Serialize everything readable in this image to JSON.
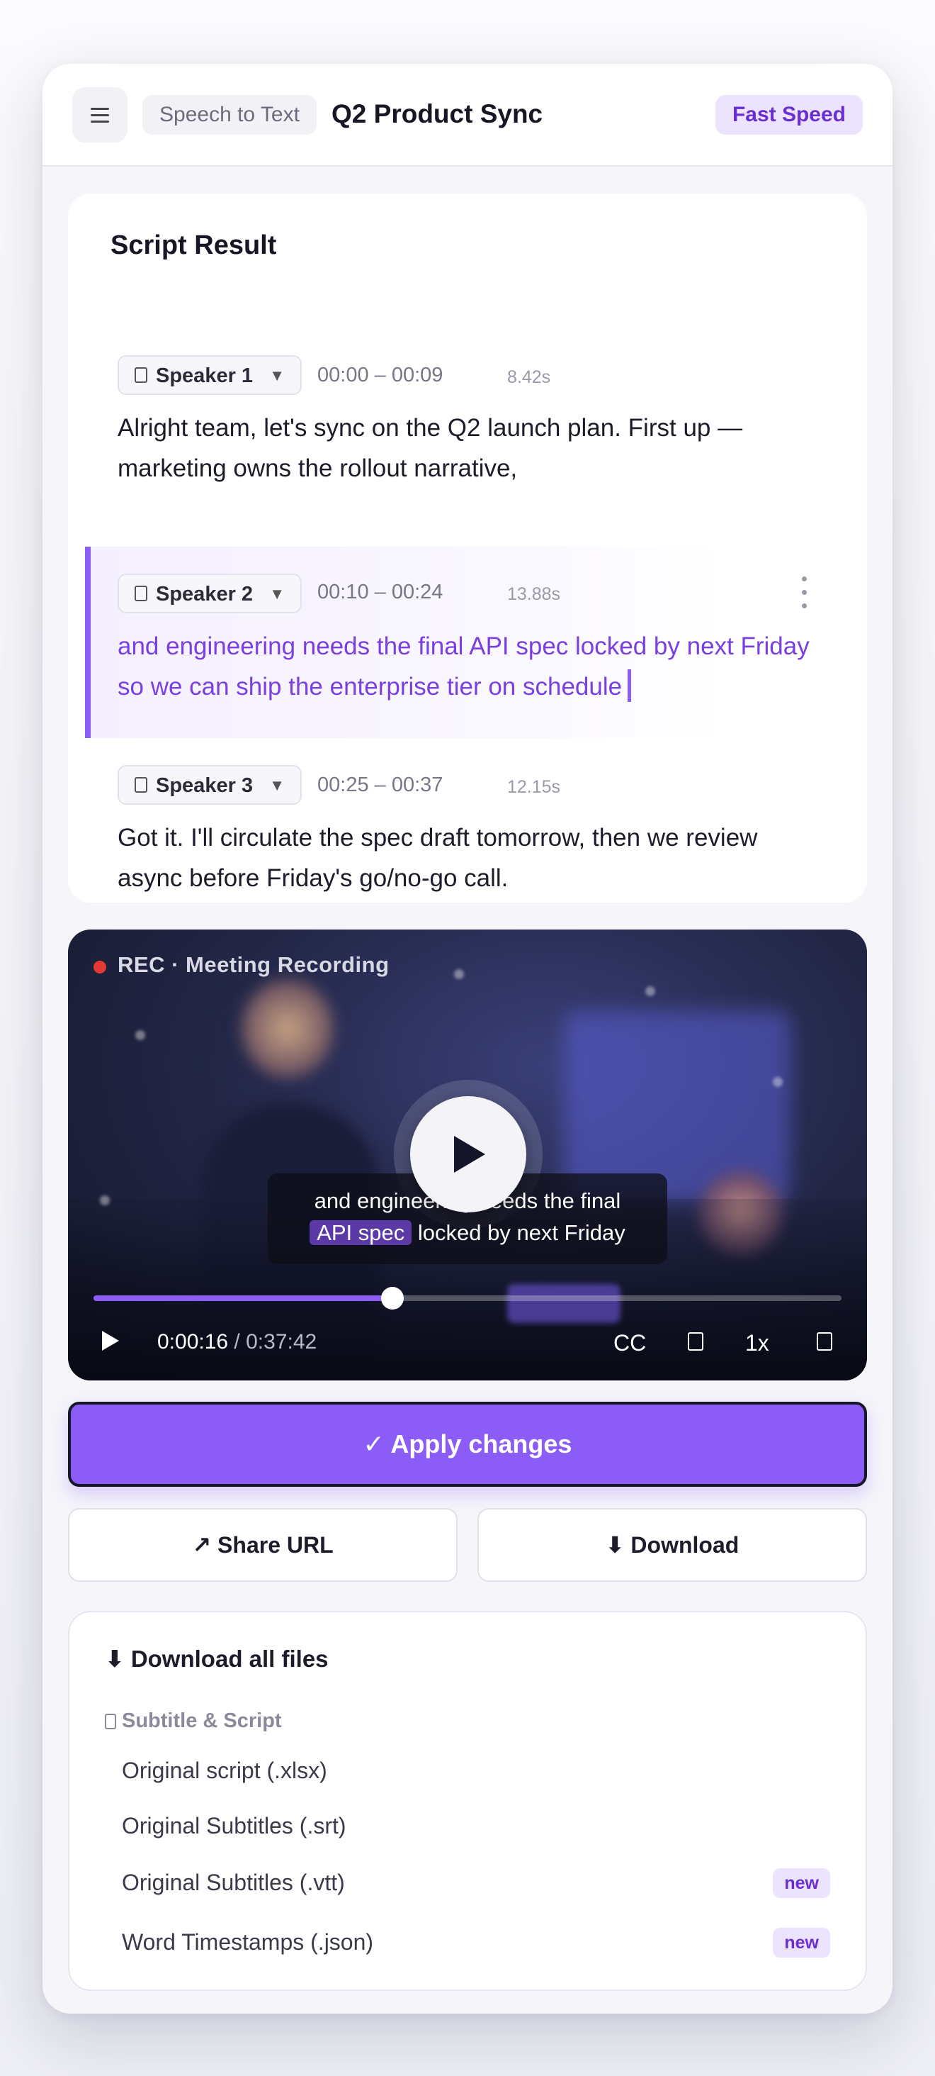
{
  "header": {
    "app_chip": "Speech to Text",
    "title": "Q2 Product Sync",
    "speed_badge": "Fast Speed"
  },
  "script": {
    "title": "Script Result",
    "segments": [
      {
        "speaker": "Speaker 1",
        "time": "00:00 – 00:09",
        "duration": "8.42s",
        "text": "Alright team, let's sync on the Q2 launch plan. First up — marketing owns the rollout narrative,"
      },
      {
        "speaker": "Speaker 2",
        "time": "00:10 – 00:24",
        "duration": "13.88s",
        "text": "and engineering needs the final API spec locked by next Friday so we can ship the enterprise tier on schedule"
      },
      {
        "speaker": "Speaker 3",
        "time": "00:25 – 00:37",
        "duration": "12.15s",
        "text": "Got it. I'll circulate the spec draft tomorrow, then we review async before Friday's go/no-go call."
      }
    ]
  },
  "video": {
    "rec_label": "REC · Meeting Recording",
    "caption_line1": "and engineering needs the final",
    "caption_highlight": "API spec",
    "caption_line2_rest": "locked by next Friday",
    "current_time": "0:00:16",
    "separator": " / ",
    "total_time": "0:37:42",
    "progress_fraction": 0.4,
    "cc_label": "CC",
    "speed_label": "1x"
  },
  "actions": {
    "apply_label": "✓ Apply changes",
    "share_label": "↗ Share URL",
    "download_label": "⬇ Download"
  },
  "downloads": {
    "title": "⬇ Download all files",
    "section": "Subtitle & Script",
    "items": [
      {
        "label": "Original script (.xlsx)",
        "badge": ""
      },
      {
        "label": "Original Subtitles (.srt)",
        "badge": ""
      },
      {
        "label": "Original Subtitles (.vtt)",
        "badge": "new"
      },
      {
        "label": "Word Timestamps (.json)",
        "badge": "new"
      }
    ]
  },
  "colors": {
    "accent": "#8b5cf6",
    "accent_text": "#7a3fe0",
    "badge_bg": "#ece4ff",
    "rec_red": "#e53935"
  }
}
